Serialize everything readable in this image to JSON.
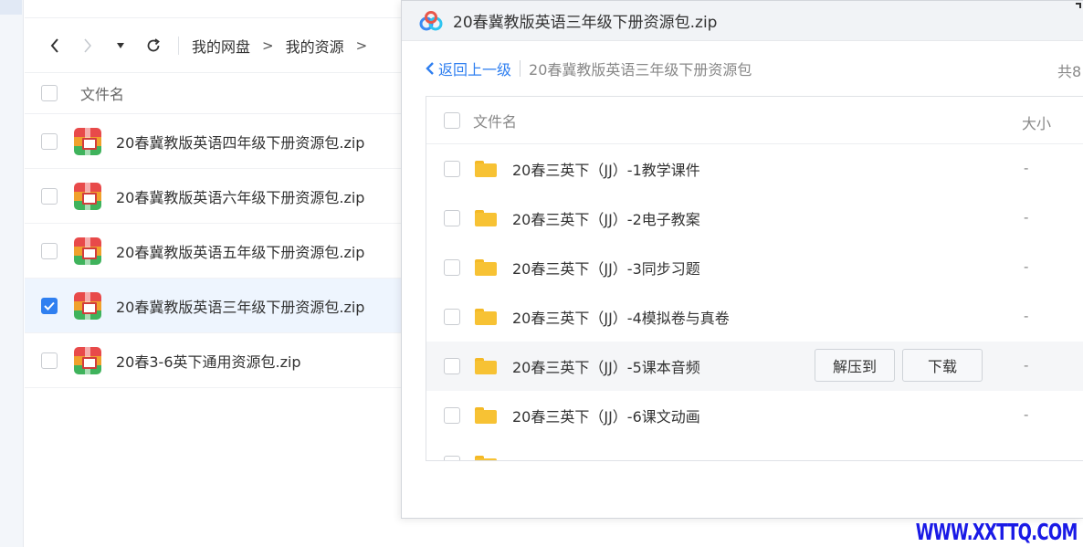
{
  "nav": {
    "breadcrumb": [
      "我的网盘",
      "我的资源"
    ],
    "crumb_sep": ">"
  },
  "file_list": {
    "header": "文件名",
    "items": [
      {
        "name": "20春冀教版英语四年级下册资源包.zip",
        "checked": false
      },
      {
        "name": "20春冀教版英语六年级下册资源包.zip",
        "checked": false
      },
      {
        "name": "20春冀教版英语五年级下册资源包.zip",
        "checked": false
      },
      {
        "name": "20春冀教版英语三年级下册资源包.zip",
        "checked": true
      },
      {
        "name": "20春3-6英下通用资源包.zip",
        "checked": false
      }
    ]
  },
  "dialog": {
    "title": "20春冀教版英语三年级下册资源包.zip",
    "back_label": "返回上一级",
    "path": "20春冀教版英语三年级下册资源包",
    "count": "共8",
    "col_name": "文件名",
    "col_size": "大小",
    "extract_label": "解压到",
    "download_label": "下载",
    "items": [
      {
        "name": "20春三英下（JJ）-1教学课件",
        "size": "-"
      },
      {
        "name": "20春三英下（JJ）-2电子教案",
        "size": "-"
      },
      {
        "name": "20春三英下（JJ）-3同步习题",
        "size": "-"
      },
      {
        "name": "20春三英下（JJ）-4模拟卷与真卷",
        "size": "-"
      },
      {
        "name": "20春三英下（JJ）-5课本音频",
        "size": "-"
      },
      {
        "name": "20春三英下（JJ）-6课文动画",
        "size": "-"
      }
    ]
  },
  "watermark": "WWW.XXTTQ.COM",
  "colors": {
    "accent": "#2f7ff0",
    "folder": "#f7c234",
    "watermark": "#1a1ae6"
  }
}
